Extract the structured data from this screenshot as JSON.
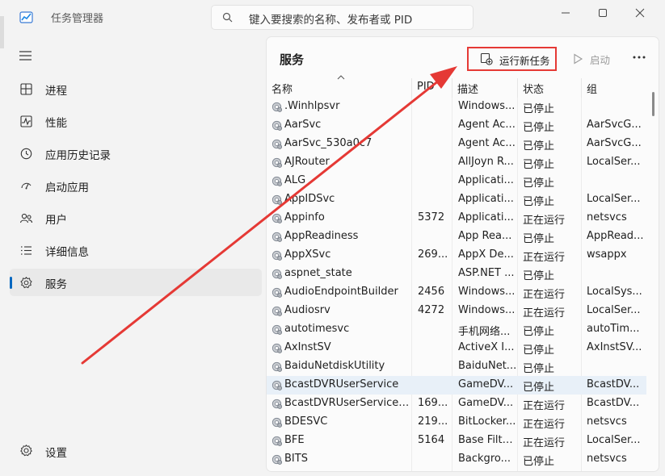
{
  "window": {
    "title": "任务管理器",
    "search_placeholder": "键入要搜索的名称、发布者或 PID"
  },
  "sidebar": {
    "items": [
      {
        "label": "进程",
        "icon": "processes-icon"
      },
      {
        "label": "性能",
        "icon": "performance-icon"
      },
      {
        "label": "应用历史记录",
        "icon": "app-history-icon"
      },
      {
        "label": "启动应用",
        "icon": "startup-apps-icon"
      },
      {
        "label": "用户",
        "icon": "users-icon"
      },
      {
        "label": "详细信息",
        "icon": "details-icon"
      },
      {
        "label": "服务",
        "icon": "services-icon",
        "active": true
      }
    ],
    "settings_label": "设置"
  },
  "main": {
    "title": "服务",
    "run_new_task_label": "运行新任务",
    "start_label": "启动",
    "columns": [
      "名称",
      "PID",
      "描述",
      "状态",
      "组"
    ],
    "rows": [
      {
        "name": ".Winhlpsvr",
        "pid": "",
        "desc": "Windows...",
        "status": "已停止",
        "group": ""
      },
      {
        "name": "AarSvc",
        "pid": "",
        "desc": "Agent Ac...",
        "status": "已停止",
        "group": "AarSvcG..."
      },
      {
        "name": "AarSvc_530a0c7",
        "pid": "",
        "desc": "Agent Ac...",
        "status": "已停止",
        "group": "AarSvcG..."
      },
      {
        "name": "AJRouter",
        "pid": "",
        "desc": "AllJoyn R...",
        "status": "已停止",
        "group": "LocalSer..."
      },
      {
        "name": "ALG",
        "pid": "",
        "desc": "Applicati...",
        "status": "已停止",
        "group": ""
      },
      {
        "name": "AppIDSvc",
        "pid": "",
        "desc": "Applicati...",
        "status": "已停止",
        "group": "LocalSer..."
      },
      {
        "name": "Appinfo",
        "pid": "5372",
        "desc": "Applicati...",
        "status": "正在运行",
        "group": "netsvcs"
      },
      {
        "name": "AppReadiness",
        "pid": "",
        "desc": "App Rea...",
        "status": "已停止",
        "group": "AppRead..."
      },
      {
        "name": "AppXSvc",
        "pid": "269...",
        "desc": "AppX De...",
        "status": "正在运行",
        "group": "wsappx"
      },
      {
        "name": "aspnet_state",
        "pid": "",
        "desc": "ASP.NET ...",
        "status": "已停止",
        "group": ""
      },
      {
        "name": "AudioEndpointBuilder",
        "pid": "2456",
        "desc": "Windows...",
        "status": "正在运行",
        "group": "LocalSys..."
      },
      {
        "name": "Audiosrv",
        "pid": "4272",
        "desc": "Windows...",
        "status": "正在运行",
        "group": "LocalSer..."
      },
      {
        "name": "autotimesvc",
        "pid": "",
        "desc": "手机网络...",
        "status": "已停止",
        "group": "autoTim..."
      },
      {
        "name": "AxInstSV",
        "pid": "",
        "desc": "ActiveX I...",
        "status": "已停止",
        "group": "AxInstSV..."
      },
      {
        "name": "BaiduNetdiskUtility",
        "pid": "",
        "desc": "BaiduNet...",
        "status": "已停止",
        "group": ""
      },
      {
        "name": "BcastDVRUserService",
        "pid": "",
        "desc": "GameDV...",
        "status": "已停止",
        "group": "BcastDV...",
        "selected": true
      },
      {
        "name": "BcastDVRUserService_...",
        "pid": "169...",
        "desc": "GameDV...",
        "status": "正在运行",
        "group": "BcastDV..."
      },
      {
        "name": "BDESVC",
        "pid": "219...",
        "desc": "BitLocker...",
        "status": "正在运行",
        "group": "netsvcs"
      },
      {
        "name": "BFE",
        "pid": "5164",
        "desc": "Base Filte...",
        "status": "正在运行",
        "group": "LocalSer..."
      },
      {
        "name": "BITS",
        "pid": "",
        "desc": "Backgro...",
        "status": "已停止",
        "group": "netsvcs"
      }
    ]
  },
  "colors": {
    "accent": "#0067c0",
    "highlight_box": "#e53935",
    "arrow": "#e53935",
    "selected_row": "#e8f0f8"
  }
}
